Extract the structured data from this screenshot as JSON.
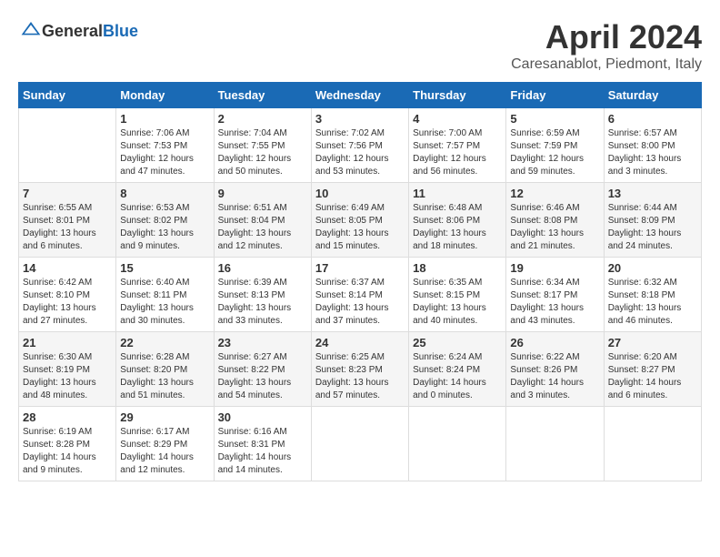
{
  "header": {
    "logo_general": "General",
    "logo_blue": "Blue",
    "month_title": "April 2024",
    "location": "Caresanablot, Piedmont, Italy"
  },
  "weekdays": [
    "Sunday",
    "Monday",
    "Tuesday",
    "Wednesday",
    "Thursday",
    "Friday",
    "Saturday"
  ],
  "weeks": [
    [
      {
        "day": "",
        "info": ""
      },
      {
        "day": "1",
        "info": "Sunrise: 7:06 AM\nSunset: 7:53 PM\nDaylight: 12 hours\nand 47 minutes."
      },
      {
        "day": "2",
        "info": "Sunrise: 7:04 AM\nSunset: 7:55 PM\nDaylight: 12 hours\nand 50 minutes."
      },
      {
        "day": "3",
        "info": "Sunrise: 7:02 AM\nSunset: 7:56 PM\nDaylight: 12 hours\nand 53 minutes."
      },
      {
        "day": "4",
        "info": "Sunrise: 7:00 AM\nSunset: 7:57 PM\nDaylight: 12 hours\nand 56 minutes."
      },
      {
        "day": "5",
        "info": "Sunrise: 6:59 AM\nSunset: 7:59 PM\nDaylight: 12 hours\nand 59 minutes."
      },
      {
        "day": "6",
        "info": "Sunrise: 6:57 AM\nSunset: 8:00 PM\nDaylight: 13 hours\nand 3 minutes."
      }
    ],
    [
      {
        "day": "7",
        "info": "Sunrise: 6:55 AM\nSunset: 8:01 PM\nDaylight: 13 hours\nand 6 minutes."
      },
      {
        "day": "8",
        "info": "Sunrise: 6:53 AM\nSunset: 8:02 PM\nDaylight: 13 hours\nand 9 minutes."
      },
      {
        "day": "9",
        "info": "Sunrise: 6:51 AM\nSunset: 8:04 PM\nDaylight: 13 hours\nand 12 minutes."
      },
      {
        "day": "10",
        "info": "Sunrise: 6:49 AM\nSunset: 8:05 PM\nDaylight: 13 hours\nand 15 minutes."
      },
      {
        "day": "11",
        "info": "Sunrise: 6:48 AM\nSunset: 8:06 PM\nDaylight: 13 hours\nand 18 minutes."
      },
      {
        "day": "12",
        "info": "Sunrise: 6:46 AM\nSunset: 8:08 PM\nDaylight: 13 hours\nand 21 minutes."
      },
      {
        "day": "13",
        "info": "Sunrise: 6:44 AM\nSunset: 8:09 PM\nDaylight: 13 hours\nand 24 minutes."
      }
    ],
    [
      {
        "day": "14",
        "info": "Sunrise: 6:42 AM\nSunset: 8:10 PM\nDaylight: 13 hours\nand 27 minutes."
      },
      {
        "day": "15",
        "info": "Sunrise: 6:40 AM\nSunset: 8:11 PM\nDaylight: 13 hours\nand 30 minutes."
      },
      {
        "day": "16",
        "info": "Sunrise: 6:39 AM\nSunset: 8:13 PM\nDaylight: 13 hours\nand 33 minutes."
      },
      {
        "day": "17",
        "info": "Sunrise: 6:37 AM\nSunset: 8:14 PM\nDaylight: 13 hours\nand 37 minutes."
      },
      {
        "day": "18",
        "info": "Sunrise: 6:35 AM\nSunset: 8:15 PM\nDaylight: 13 hours\nand 40 minutes."
      },
      {
        "day": "19",
        "info": "Sunrise: 6:34 AM\nSunset: 8:17 PM\nDaylight: 13 hours\nand 43 minutes."
      },
      {
        "day": "20",
        "info": "Sunrise: 6:32 AM\nSunset: 8:18 PM\nDaylight: 13 hours\nand 46 minutes."
      }
    ],
    [
      {
        "day": "21",
        "info": "Sunrise: 6:30 AM\nSunset: 8:19 PM\nDaylight: 13 hours\nand 48 minutes."
      },
      {
        "day": "22",
        "info": "Sunrise: 6:28 AM\nSunset: 8:20 PM\nDaylight: 13 hours\nand 51 minutes."
      },
      {
        "day": "23",
        "info": "Sunrise: 6:27 AM\nSunset: 8:22 PM\nDaylight: 13 hours\nand 54 minutes."
      },
      {
        "day": "24",
        "info": "Sunrise: 6:25 AM\nSunset: 8:23 PM\nDaylight: 13 hours\nand 57 minutes."
      },
      {
        "day": "25",
        "info": "Sunrise: 6:24 AM\nSunset: 8:24 PM\nDaylight: 14 hours\nand 0 minutes."
      },
      {
        "day": "26",
        "info": "Sunrise: 6:22 AM\nSunset: 8:26 PM\nDaylight: 14 hours\nand 3 minutes."
      },
      {
        "day": "27",
        "info": "Sunrise: 6:20 AM\nSunset: 8:27 PM\nDaylight: 14 hours\nand 6 minutes."
      }
    ],
    [
      {
        "day": "28",
        "info": "Sunrise: 6:19 AM\nSunset: 8:28 PM\nDaylight: 14 hours\nand 9 minutes."
      },
      {
        "day": "29",
        "info": "Sunrise: 6:17 AM\nSunset: 8:29 PM\nDaylight: 14 hours\nand 12 minutes."
      },
      {
        "day": "30",
        "info": "Sunrise: 6:16 AM\nSunset: 8:31 PM\nDaylight: 14 hours\nand 14 minutes."
      },
      {
        "day": "",
        "info": ""
      },
      {
        "day": "",
        "info": ""
      },
      {
        "day": "",
        "info": ""
      },
      {
        "day": "",
        "info": ""
      }
    ]
  ]
}
